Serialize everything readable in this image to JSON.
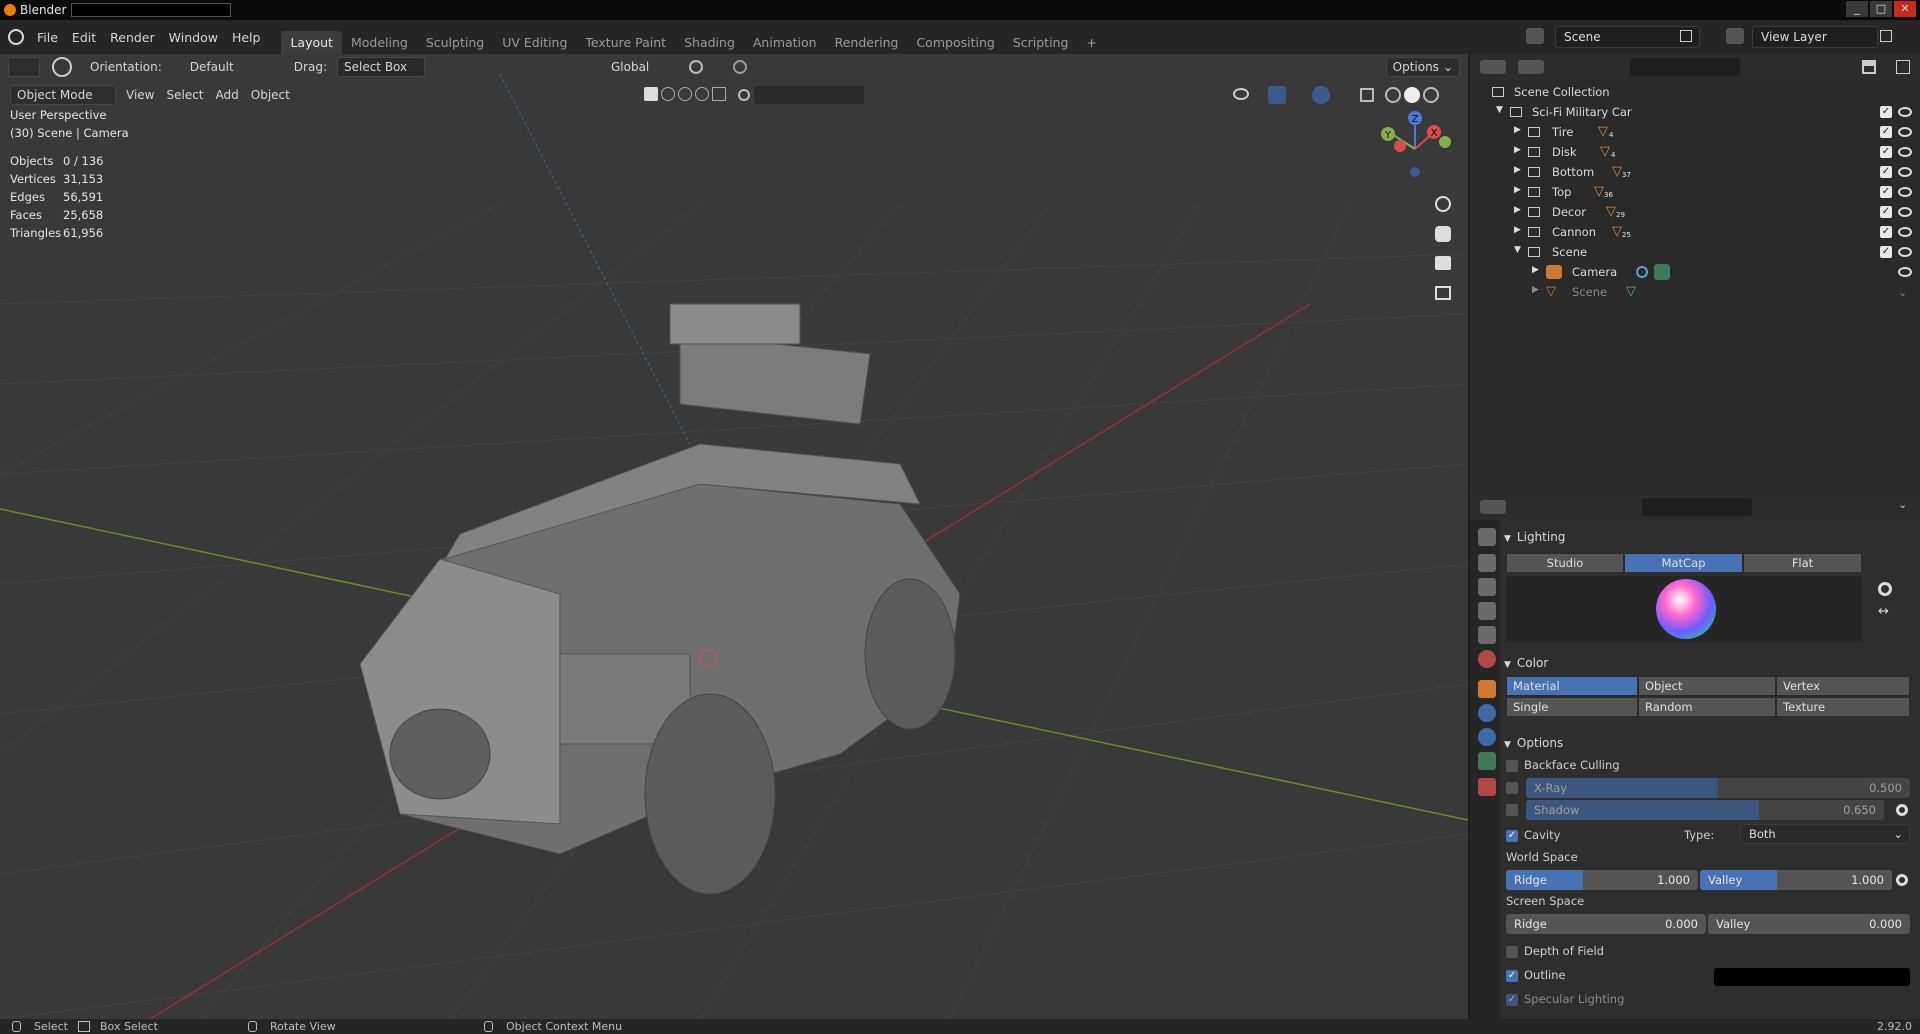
{
  "app": {
    "title": "Blender",
    "version": "2.92.0"
  },
  "menus": [
    "File",
    "Edit",
    "Render",
    "Window",
    "Help"
  ],
  "workspaces": [
    "Layout",
    "Modeling",
    "Sculpting",
    "UV Editing",
    "Texture Paint",
    "Shading",
    "Animation",
    "Rendering",
    "Compositing",
    "Scripting"
  ],
  "active_workspace": "Layout",
  "scene_field": "Scene",
  "view_layer_field": "View Layer",
  "toolbar": {
    "orientation_label": "Orientation:",
    "orientation_value": "Default",
    "drag_label": "Drag:",
    "drag_value": "Select Box",
    "transform_space": "Global",
    "options_label": "Options"
  },
  "header2": {
    "mode": "Object Mode",
    "view": "View",
    "select": "Select",
    "add": "Add",
    "object": "Object"
  },
  "viewport_info": {
    "perspective": "User Perspective",
    "context": "(30) Scene | Camera",
    "stats": [
      {
        "label": "Objects",
        "value": "0 / 136"
      },
      {
        "label": "Vertices",
        "value": "31,153"
      },
      {
        "label": "Edges",
        "value": "56,591"
      },
      {
        "label": "Faces",
        "value": "25,658"
      },
      {
        "label": "Triangles",
        "value": "61,956"
      }
    ]
  },
  "gizmo": {
    "z": "Z",
    "y": "Y",
    "x": "X"
  },
  "outliner": {
    "root": "Scene Collection",
    "collection": "Sci-Fi Military Car",
    "children": [
      {
        "name": "Tire",
        "count": "4"
      },
      {
        "name": "Disk",
        "count": "4"
      },
      {
        "name": "Bottom",
        "count": "37"
      },
      {
        "name": "Top",
        "count": "36"
      },
      {
        "name": "Decor",
        "count": "29"
      },
      {
        "name": "Cannon",
        "count": "25"
      }
    ],
    "scene_collection": "Scene",
    "camera": "Camera",
    "scene_mesh": "Scene"
  },
  "properties": {
    "lighting": {
      "title": "Lighting",
      "options": [
        "Studio",
        "MatCap",
        "Flat"
      ],
      "selected": "MatCap"
    },
    "color": {
      "title": "Color",
      "options": [
        "Material",
        "Object",
        "Vertex",
        "Single",
        "Random",
        "Texture"
      ],
      "selected": "Material"
    },
    "options": {
      "title": "Options",
      "backface_culling": "Backface Culling",
      "xray_label": "X-Ray",
      "xray_value": "0.500",
      "xray_fraction": 0.5,
      "shadow_label": "Shadow",
      "shadow_value": "0.650",
      "shadow_fraction": 0.65,
      "cavity": "Cavity",
      "type_label": "Type:",
      "type_value": "Both",
      "world_space": "World Space",
      "ws_ridge_label": "Ridge",
      "ws_ridge_value": "1.000",
      "ws_valley_label": "Valley",
      "ws_valley_value": "1.000",
      "screen_space": "Screen Space",
      "ss_ridge_label": "Ridge",
      "ss_ridge_value": "0.000",
      "ss_valley_label": "Valley",
      "ss_valley_value": "0.000",
      "dof": "Depth of Field",
      "outline": "Outline",
      "specular": "Specular Lighting"
    }
  },
  "statusbar": {
    "select": "Select",
    "box_select": "Box Select",
    "rotate": "Rotate View",
    "context_menu": "Object Context Menu",
    "version": "2.92.0"
  },
  "colors": {
    "accent": "#4772b3",
    "viewport_bg": "#393939",
    "panel_bg": "#2e2e2e"
  }
}
